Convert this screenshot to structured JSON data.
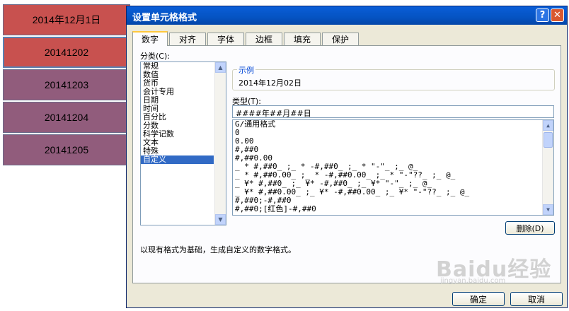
{
  "sheet": {
    "cells": [
      "2014年12月1日",
      "20141202",
      "20141203",
      "20141204",
      "20141205"
    ]
  },
  "dialog": {
    "title": "设置单元格格式",
    "help_glyph": "?",
    "close_glyph": "✕",
    "tabs": [
      "数字",
      "对齐",
      "字体",
      "边框",
      "填充",
      "保护"
    ],
    "category_label": "分类(C):",
    "categories": [
      "常规",
      "数值",
      "货币",
      "会计专用",
      "日期",
      "时间",
      "百分比",
      "分数",
      "科学记数",
      "文本",
      "特殊",
      "自定义"
    ],
    "selected_category": "自定义",
    "sample_legend": "示例",
    "sample_value": "2014年12月02日",
    "type_label": "类型(T):",
    "type_value": "####年##月##日",
    "formats": [
      "G/通用格式",
      "0",
      "0.00",
      "#,##0",
      "#,##0.00",
      "_ * #,##0_ ;_ * -#,##0_ ;_ * \"-\"_ ;_ @_",
      "_ * #,##0.00_ ;_ * -#,##0.00_ ;_ * \"-\"??_ ;_ @_",
      "_ ¥* #,##0_ ;_ ¥* -#,##0_ ;_ ¥* \"-\"_ ;_ @_",
      "_ ¥* #,##0.00_ ;_ ¥* -#,##0.00_ ;_ ¥* \"-\"??_ ;_ @_",
      "#,##0;-#,##0",
      "#,##0;[红色]-#,##0"
    ],
    "delete_label": "删除(D)",
    "description": "以现有格式为基础，生成自定义的数字格式。",
    "ok_label": "确定",
    "cancel_label": "取消"
  },
  "watermark": {
    "brand": "Baidu经验",
    "url": "jingyan.baidu.com"
  },
  "colors": {
    "titlebar": "#0553c2",
    "cell_red": "#c8514f",
    "cell_purple": "#915c7c",
    "selection": "#316ac5",
    "dialog_bg": "#ece9d8"
  }
}
